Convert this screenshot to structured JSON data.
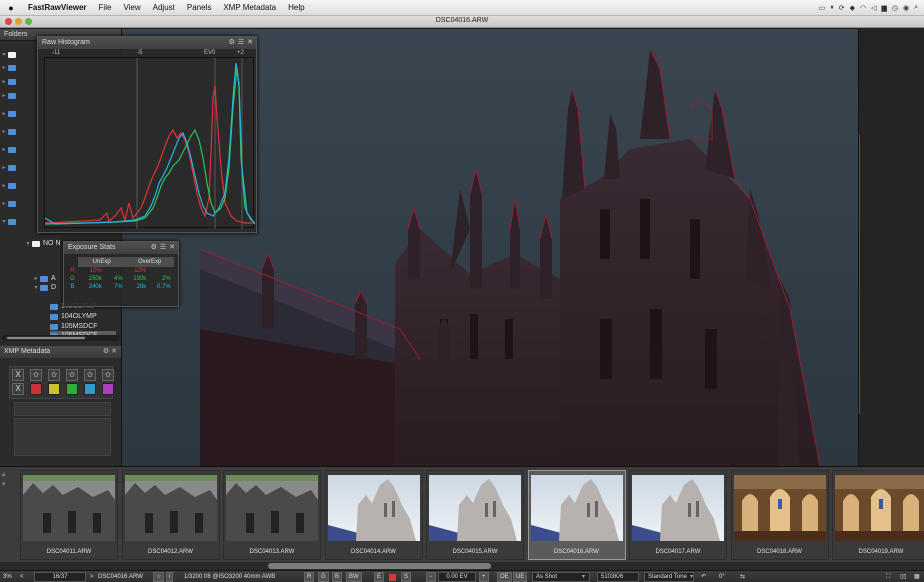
{
  "menubar": {
    "app_name": "FastRawViewer",
    "items": [
      "File",
      "View",
      "Adjust",
      "Panels",
      "XMP Metadata",
      "Help"
    ]
  },
  "window": {
    "title": "DSC04016.ARW"
  },
  "folders": {
    "title": "Folders",
    "items": [
      {
        "label": "NO N",
        "type": "folder-white"
      },
      {
        "label": "A",
        "type": "folder"
      },
      {
        "label": "D",
        "type": "folder"
      },
      {
        "label": "102OLYMP",
        "type": "folder"
      },
      {
        "label": "104OLYMP",
        "type": "folder"
      },
      {
        "label": "105MSDCF",
        "type": "folder"
      },
      {
        "label": "106MSDCF",
        "type": "folder",
        "selected": true
      }
    ]
  },
  "histogram": {
    "title": "Raw Histogram",
    "ticks": [
      "-11",
      "-5",
      "EV0",
      "+2"
    ]
  },
  "exposure_stats": {
    "title": "Exposure Stats",
    "columns": [
      "UnExp",
      "OverExp"
    ],
    "rows": [
      {
        "ch": "R",
        "v": [
          "10%",
          "",
          "12%",
          ""
        ],
        "color": "#e0323a"
      },
      {
        "ch": "G",
        "v": [
          "250k",
          "4%",
          "190k",
          "2%"
        ],
        "color": "#2cc25a"
      },
      {
        "ch": "B",
        "v": [
          "240k",
          "7%",
          "28k",
          "0.7%"
        ],
        "color": "#26b5e0"
      }
    ]
  },
  "xmp": {
    "title": "XMP Metadata",
    "reject_label": "X",
    "star": "✩",
    "label_colors": [
      "#c8323a",
      "#c8c232",
      "#2fae3a",
      "#2a9ec8",
      "#b040b8"
    ]
  },
  "filmstrip": {
    "items": [
      {
        "name": "DSC04011.ARW",
        "kind": "grey"
      },
      {
        "name": "DSC04012.ARW",
        "kind": "grey"
      },
      {
        "name": "DSC04013.ARW",
        "kind": "grey"
      },
      {
        "name": "DSC04014.ARW",
        "kind": "sky"
      },
      {
        "name": "DSC04015.ARW",
        "kind": "sky"
      },
      {
        "name": "DSC04016.ARW",
        "kind": "sky",
        "selected": true
      },
      {
        "name": "DSC04017.ARW",
        "kind": "sky"
      },
      {
        "name": "DSC04018.ARW",
        "kind": "interior"
      },
      {
        "name": "DSC04019.ARW",
        "kind": "interior"
      }
    ]
  },
  "statusbar": {
    "zoom": "3%",
    "counter": "16/37",
    "filename": "DSC04016.ARW",
    "exif": "1/3200 f/8 @ISO3200 40mm AWB",
    "channels": [
      "R",
      "G",
      "B",
      "BW"
    ],
    "marks": [
      "E",
      "S"
    ],
    "ev": "0.00 EV",
    "oe": "OE",
    "ue": "UE",
    "wb": "As Shot",
    "temp": "5103K/6",
    "tone": "Standard Tone",
    "rotate": "0°"
  }
}
